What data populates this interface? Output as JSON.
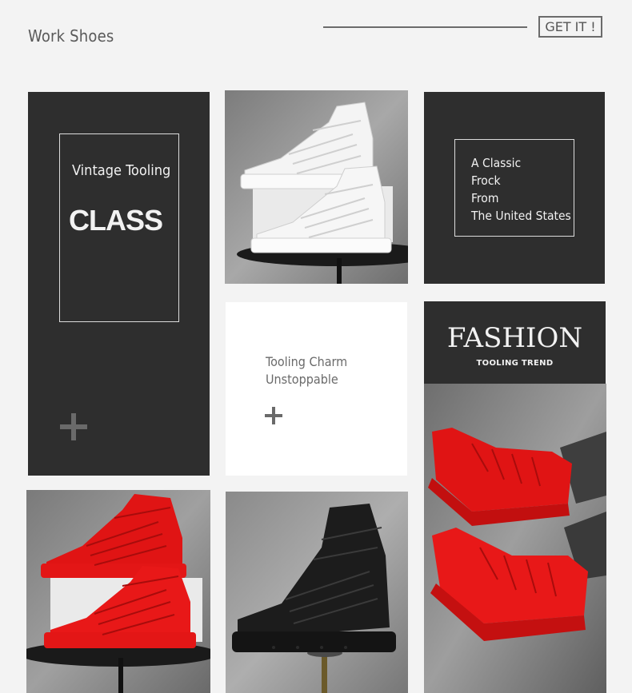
{
  "header": {
    "title": "Work Shoes",
    "cta_label": "GET IT !"
  },
  "tiles": {
    "vintage": {
      "subtitle": "Vintage Tooling",
      "title": "CLASS"
    },
    "classic": {
      "lines": [
        "A Classic",
        "Frock",
        "From",
        "The United States"
      ]
    },
    "charm": {
      "line1": "Tooling Charm",
      "line2": "Unstoppable"
    },
    "fashion": {
      "title": "FASHION",
      "subtitle": "TOOLING TREND"
    }
  },
  "colors": {
    "dark_panel": "#2e2e2e",
    "red_shoe": "#e01414",
    "white_shoe": "#f4f4f4",
    "black_shoe": "#1c1c1c",
    "concrete": "#8e8e8e"
  },
  "icons": [
    "plus-icon"
  ]
}
